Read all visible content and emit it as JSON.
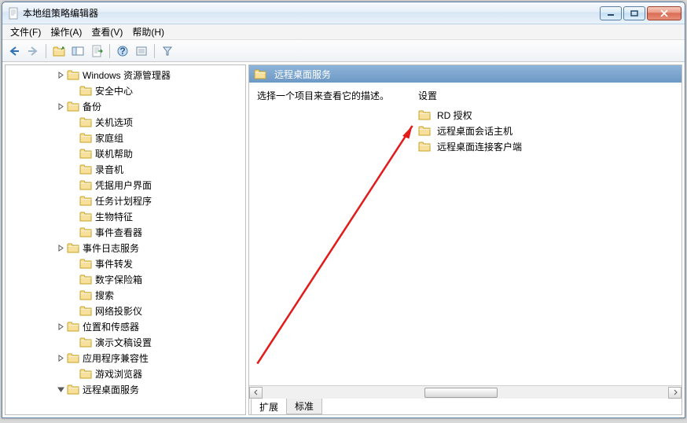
{
  "window": {
    "title": "本地组策略编辑器"
  },
  "menu": {
    "file": "文件(F)",
    "action": "操作(A)",
    "view": "查看(V)",
    "help": "帮助(H)"
  },
  "tree": [
    {
      "indent": 4,
      "exp": "closed",
      "label": "Windows 资源管理器"
    },
    {
      "indent": 5,
      "exp": "none",
      "label": "安全中心"
    },
    {
      "indent": 4,
      "exp": "closed",
      "label": "备份"
    },
    {
      "indent": 5,
      "exp": "none",
      "label": "关机选项"
    },
    {
      "indent": 5,
      "exp": "none",
      "label": "家庭组"
    },
    {
      "indent": 5,
      "exp": "none",
      "label": "联机帮助"
    },
    {
      "indent": 5,
      "exp": "none",
      "label": "录音机"
    },
    {
      "indent": 5,
      "exp": "none",
      "label": "凭据用户界面"
    },
    {
      "indent": 5,
      "exp": "none",
      "label": "任务计划程序"
    },
    {
      "indent": 5,
      "exp": "none",
      "label": "生物特征"
    },
    {
      "indent": 5,
      "exp": "none",
      "label": "事件查看器"
    },
    {
      "indent": 4,
      "exp": "closed",
      "label": "事件日志服务"
    },
    {
      "indent": 5,
      "exp": "none",
      "label": "事件转发"
    },
    {
      "indent": 5,
      "exp": "none",
      "label": "数字保险箱"
    },
    {
      "indent": 5,
      "exp": "none",
      "label": "搜索"
    },
    {
      "indent": 5,
      "exp": "none",
      "label": "网络投影仪"
    },
    {
      "indent": 4,
      "exp": "closed",
      "label": "位置和传感器"
    },
    {
      "indent": 5,
      "exp": "none",
      "label": "演示文稿设置"
    },
    {
      "indent": 4,
      "exp": "closed",
      "label": "应用程序兼容性"
    },
    {
      "indent": 5,
      "exp": "none",
      "label": "游戏浏览器"
    },
    {
      "indent": 4,
      "exp": "open",
      "label": "远程桌面服务"
    }
  ],
  "right": {
    "header": "远程桌面服务",
    "description": "选择一个项目来查看它的描述。",
    "settings_header": "设置",
    "items": [
      {
        "label": "RD 授权"
      },
      {
        "label": "远程桌面会话主机"
      },
      {
        "label": "远程桌面连接客户端"
      }
    ]
  },
  "tabs": {
    "ext": "扩展",
    "std": "标准"
  }
}
